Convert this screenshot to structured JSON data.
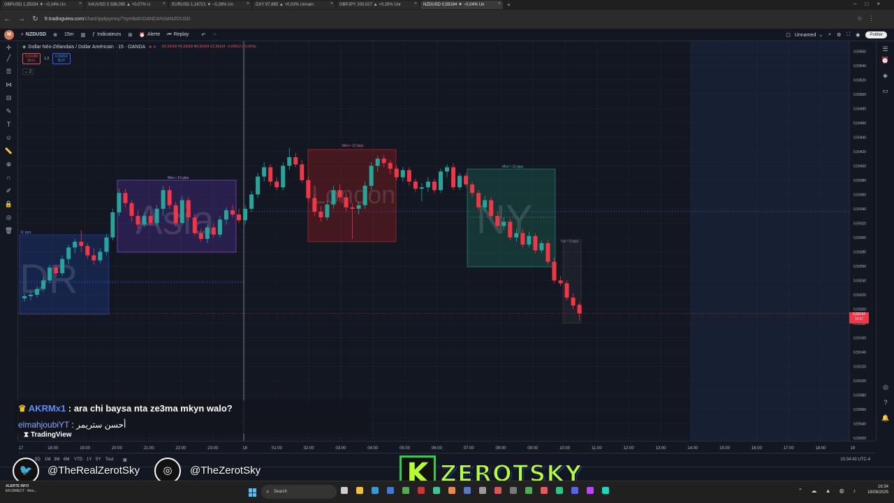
{
  "browser": {
    "tabs": [
      {
        "label": "GBPUSD 1,35334 ▼ −0,14% Un"
      },
      {
        "label": "XAUUSD 3 338,095 ▲ +0,07% U"
      },
      {
        "label": "EURUSD 1,16721 ▼ −0,28% Un"
      },
      {
        "label": "DXY 97,865 ▲ +0,03% Unnam"
      },
      {
        "label": "GBPJPY 200,027 ▲ +0,29% Unr"
      },
      {
        "label": "NZDUSD 0,59194 ▼ −0,04% Un"
      }
    ],
    "url_host": "fr.tradingview.com",
    "url_path": "/chart/qq4pynmy/?symbol=OANDA%3ANZDUSD"
  },
  "toolbar": {
    "symbol": "NZDUSD",
    "interval": "15m",
    "indicators": "Indicateurs",
    "alert": "Alerte",
    "replay": "Replay",
    "layout_name": "Unnamed",
    "publish": "Publier"
  },
  "legend": {
    "title": "Dollar Néo-Zélandais / Dollar Américain · 15 · OANDA",
    "o_label": "O",
    "o": "0,59206",
    "h_label": "H",
    "h": "0,59209",
    "l_label": "B",
    "l": "0,59184",
    "c_label": "C",
    "c": "0,59194",
    "change": "−0,00012 (−0,02%)",
    "sell_price": "0,59189",
    "sell": "SELL",
    "spread": "1,3",
    "buy_price": "0,59202",
    "buy": "BUY",
    "indicator_count": "2"
  },
  "sessions": {
    "dr": {
      "label": "DR",
      "pips": "11 pips"
    },
    "asia": {
      "label": "Asia",
      "pips": "Mon • 10 pips"
    },
    "london": {
      "label": "London",
      "pips": "Mon • 12 pips"
    },
    "ny": {
      "label": "NY",
      "pips": "Mon • 12 pips"
    },
    "tue": {
      "pips": "Tue • 9 pips"
    }
  },
  "price_axis": {
    "labels": [
      "0,59560",
      "0,59540",
      "0,59520",
      "0,59500",
      "0,59480",
      "0,59460",
      "0,59440",
      "0,59420",
      "0,59400",
      "0,59380",
      "0,59360",
      "0,59340",
      "0,59320",
      "0,59300",
      "0,59280",
      "0,59260",
      "0,59240",
      "0,59220",
      "0,59200",
      "0,59180",
      "0,59160",
      "0,59140",
      "0,59120",
      "0,59100",
      "0,59080",
      "0,59060",
      "0,59040",
      "0,59020"
    ],
    "current_price": "0,59194",
    "countdown": "10:17"
  },
  "time_axis": {
    "labels": [
      "17",
      "18:00",
      "19:00",
      "20:00",
      "21:00",
      "22:00",
      "23:00",
      "18",
      "01:00",
      "02:00",
      "03:00",
      "04:00",
      "05:00",
      "06:00",
      "07:00",
      "08:00",
      "09:00",
      "10:00",
      "11:00",
      "12:00",
      "13:00",
      "14:00",
      "15:00",
      "16:00",
      "17:00",
      "18:00",
      "19"
    ]
  },
  "ranges": {
    "items": [
      "5D",
      "1M",
      "3M",
      "6M",
      "YTD",
      "1Y",
      "5Y",
      "Tout"
    ],
    "clock": "10:34:43 UTC-4"
  },
  "chat": {
    "msg1_user": "AKRMx1",
    "msg1_text": ": ara chi baysa nta ze3ma mkyn walo?",
    "msg2_user": "elmahjoubiYT",
    "msg2_text": ": أحسن ستريمر",
    "tv_logo": "TradingView"
  },
  "overlay": {
    "twitter": "@TheRealZerotSky",
    "instagram": "@TheZerotSky",
    "brand_k": "K",
    "brand": "ZEROTSKY"
  },
  "taskbar": {
    "alert_title": "ALERTE INFO",
    "alert_sub": "EN DIRECT - Ren...",
    "search": "Search",
    "time": "16:34",
    "date": "18/08/2025"
  },
  "colors": {
    "bull": "#26a69a",
    "bear": "#f23645",
    "background": "#131722",
    "accent_brand": "#b6ff2e"
  },
  "chart_data": {
    "type": "candlestick",
    "interval": "15m",
    "yrange": [
      0.5902,
      0.5957
    ],
    "candles": [
      [
        0.59215,
        0.59222,
        0.5921,
        0.59218
      ],
      [
        0.59218,
        0.59225,
        0.59212,
        0.5922
      ],
      [
        0.5922,
        0.59232,
        0.59216,
        0.59228
      ],
      [
        0.59228,
        0.59245,
        0.59224,
        0.5924
      ],
      [
        0.5924,
        0.59262,
        0.59236,
        0.59258
      ],
      [
        0.59258,
        0.59262,
        0.59245,
        0.5925
      ],
      [
        0.5925,
        0.59275,
        0.59246,
        0.5927
      ],
      [
        0.5927,
        0.5929,
        0.59262,
        0.59286
      ],
      [
        0.59286,
        0.59298,
        0.59278,
        0.59294
      ],
      [
        0.59294,
        0.5931,
        0.5928,
        0.59288
      ],
      [
        0.59288,
        0.59292,
        0.5927,
        0.59275
      ],
      [
        0.59275,
        0.59285,
        0.59262,
        0.59268
      ],
      [
        0.59268,
        0.59285,
        0.59264,
        0.5928
      ],
      [
        0.5928,
        0.59305,
        0.59275,
        0.593
      ],
      [
        0.593,
        0.5934,
        0.59296,
        0.59335
      ],
      [
        0.59335,
        0.59368,
        0.5933,
        0.59362
      ],
      [
        0.59362,
        0.59368,
        0.59342,
        0.59348
      ],
      [
        0.59348,
        0.59352,
        0.59322,
        0.5933
      ],
      [
        0.5933,
        0.59338,
        0.59312,
        0.59318
      ],
      [
        0.59318,
        0.59335,
        0.59314,
        0.5933
      ],
      [
        0.5933,
        0.59336,
        0.59316,
        0.5932
      ],
      [
        0.5932,
        0.59345,
        0.59316,
        0.5934
      ],
      [
        0.5934,
        0.59372,
        0.5933,
        0.59366
      ],
      [
        0.59366,
        0.59372,
        0.5934,
        0.59345
      ],
      [
        0.59345,
        0.5935,
        0.59315,
        0.5932
      ],
      [
        0.5932,
        0.59358,
        0.59316,
        0.59352
      ],
      [
        0.59352,
        0.59356,
        0.59324,
        0.59328
      ],
      [
        0.59328,
        0.59333,
        0.59302,
        0.59306
      ],
      [
        0.59306,
        0.59312,
        0.59294,
        0.59298
      ],
      [
        0.59298,
        0.59318,
        0.59292,
        0.59314
      ],
      [
        0.59314,
        0.5932,
        0.593,
        0.59304
      ],
      [
        0.59304,
        0.5933,
        0.593,
        0.59325
      ],
      [
        0.59325,
        0.59342,
        0.59318,
        0.59338
      ],
      [
        0.59338,
        0.59346,
        0.59328,
        0.59332
      ],
      [
        0.59332,
        0.5934,
        0.5932,
        0.59324
      ],
      [
        0.59324,
        0.59345,
        0.59318,
        0.5934
      ],
      [
        0.5934,
        0.59365,
        0.59336,
        0.5936
      ],
      [
        0.5936,
        0.5939,
        0.59355,
        0.59385
      ],
      [
        0.59385,
        0.59405,
        0.59378,
        0.59398
      ],
      [
        0.59398,
        0.59402,
        0.59372,
        0.59378
      ],
      [
        0.59378,
        0.59384,
        0.59366,
        0.5937
      ],
      [
        0.5937,
        0.59405,
        0.59366,
        0.594
      ],
      [
        0.594,
        0.59425,
        0.59394,
        0.59412
      ],
      [
        0.59412,
        0.59418,
        0.59398,
        0.59402
      ],
      [
        0.59402,
        0.59408,
        0.59376,
        0.5938
      ],
      [
        0.5938,
        0.59385,
        0.5935,
        0.59355
      ],
      [
        0.59355,
        0.5936,
        0.5933,
        0.59336
      ],
      [
        0.59336,
        0.59344,
        0.59322,
        0.59328
      ],
      [
        0.59328,
        0.59352,
        0.59324,
        0.59346
      ],
      [
        0.59346,
        0.59372,
        0.5934,
        0.59366
      ],
      [
        0.59366,
        0.59374,
        0.5935,
        0.59356
      ],
      [
        0.59356,
        0.59362,
        0.59336,
        0.59342
      ],
      [
        0.59342,
        0.59348,
        0.59298,
        0.5934
      ],
      [
        0.5934,
        0.5935,
        0.59332,
        0.59345
      ],
      [
        0.59345,
        0.59378,
        0.5934,
        0.59372
      ],
      [
        0.59372,
        0.59405,
        0.59366,
        0.594
      ],
      [
        0.594,
        0.59414,
        0.59392,
        0.5941
      ],
      [
        0.5941,
        0.59416,
        0.59398,
        0.59404
      ],
      [
        0.59404,
        0.59408,
        0.59388,
        0.59396
      ],
      [
        0.59396,
        0.594,
        0.5938,
        0.59384
      ],
      [
        0.59384,
        0.59398,
        0.59378,
        0.59394
      ],
      [
        0.59394,
        0.59398,
        0.59372,
        0.59378
      ],
      [
        0.59378,
        0.59382,
        0.59364,
        0.59368
      ],
      [
        0.59368,
        0.59376,
        0.5935,
        0.5937
      ],
      [
        0.5937,
        0.59384,
        0.59364,
        0.59378
      ],
      [
        0.59378,
        0.59382,
        0.59362,
        0.59366
      ],
      [
        0.59366,
        0.59396,
        0.59362,
        0.59392
      ],
      [
        0.59392,
        0.59402,
        0.59384,
        0.59398
      ],
      [
        0.59398,
        0.59404,
        0.59366,
        0.5937
      ],
      [
        0.5937,
        0.5939,
        0.59366,
        0.59386
      ],
      [
        0.59386,
        0.5939,
        0.5937,
        0.59374
      ],
      [
        0.59374,
        0.59378,
        0.59356,
        0.59362
      ],
      [
        0.59362,
        0.59366,
        0.59338,
        0.59342
      ],
      [
        0.59342,
        0.59358,
        0.59336,
        0.59352
      ],
      [
        0.59352,
        0.59356,
        0.59326,
        0.5933
      ],
      [
        0.5933,
        0.59336,
        0.59312,
        0.59316
      ],
      [
        0.59316,
        0.59328,
        0.5931,
        0.59322
      ],
      [
        0.59322,
        0.59326,
        0.59296,
        0.593
      ],
      [
        0.593,
        0.59312,
        0.59294,
        0.59306
      ],
      [
        0.59306,
        0.59312,
        0.59286,
        0.5929
      ],
      [
        0.5929,
        0.59308,
        0.59286,
        0.59302
      ],
      [
        0.59302,
        0.59306,
        0.59278,
        0.59282
      ],
      [
        0.59282,
        0.59296,
        0.59278,
        0.59292
      ],
      [
        0.59292,
        0.59296,
        0.59262,
        0.59266
      ],
      [
        0.59266,
        0.59272,
        0.59236,
        0.5924
      ],
      [
        0.5924,
        0.59246,
        0.59232,
        0.59236
      ],
      [
        0.59236,
        0.5924,
        0.59212,
        0.59216
      ],
      [
        0.59216,
        0.59222,
        0.592,
        0.59205
      ],
      [
        0.59206,
        0.59209,
        0.59184,
        0.59194
      ]
    ]
  }
}
